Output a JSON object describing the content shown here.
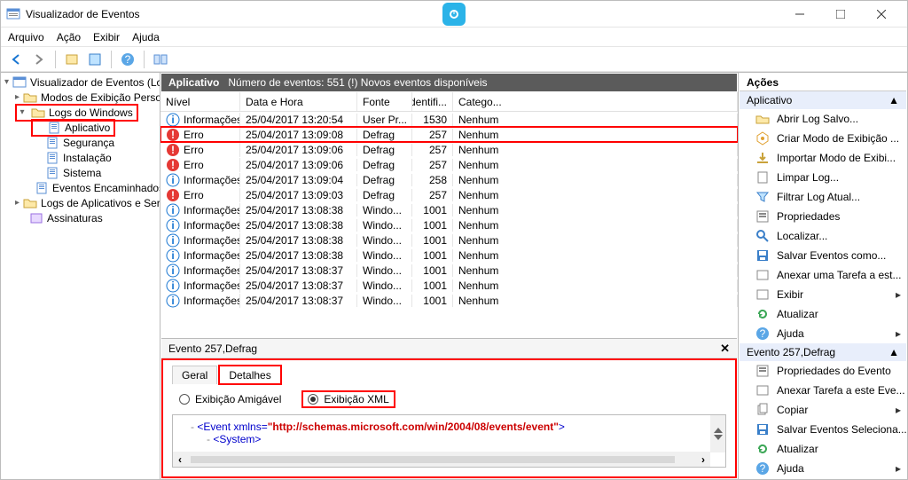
{
  "title": "Visualizador de Eventos",
  "menu": [
    "Arquivo",
    "Ação",
    "Exibir",
    "Ajuda"
  ],
  "tree": {
    "root": "Visualizador de Eventos (Local)",
    "items": [
      {
        "label": "Modos de Exibição Personali",
        "lvl": 1,
        "icon": "folder",
        "expander": "▸"
      },
      {
        "label": "Logs do Windows",
        "lvl": 1,
        "icon": "folder",
        "expander": "▾",
        "highlight": true
      },
      {
        "label": "Aplicativo",
        "lvl": 2,
        "icon": "log",
        "highlight": true
      },
      {
        "label": "Segurança",
        "lvl": 2,
        "icon": "log"
      },
      {
        "label": "Instalação",
        "lvl": 2,
        "icon": "log"
      },
      {
        "label": "Sistema",
        "lvl": 2,
        "icon": "log"
      },
      {
        "label": "Eventos Encaminhados",
        "lvl": 2,
        "icon": "log"
      },
      {
        "label": "Logs de Aplicativos e Serviço",
        "lvl": 1,
        "icon": "folder",
        "expander": "▸"
      },
      {
        "label": "Assinaturas",
        "lvl": 1,
        "icon": "subs"
      }
    ]
  },
  "center": {
    "header_title": "Aplicativo",
    "header_sub": "Número de eventos: 551 (!) Novos eventos disponíveis",
    "columns": {
      "level": "Nível",
      "date": "Data e Hora",
      "src": "Fonte",
      "id": "Identifi...",
      "cat": "Catego..."
    },
    "rows": [
      {
        "lvl": "info",
        "level": "Informações",
        "date": "25/04/2017 13:20:54",
        "src": "User Pr...",
        "id": "1530",
        "cat": "Nenhum"
      },
      {
        "lvl": "err",
        "level": "Erro",
        "date": "25/04/2017 13:09:08",
        "src": "Defrag",
        "id": "257",
        "cat": "Nenhum",
        "highlight": true
      },
      {
        "lvl": "err",
        "level": "Erro",
        "date": "25/04/2017 13:09:06",
        "src": "Defrag",
        "id": "257",
        "cat": "Nenhum"
      },
      {
        "lvl": "err",
        "level": "Erro",
        "date": "25/04/2017 13:09:06",
        "src": "Defrag",
        "id": "257",
        "cat": "Nenhum"
      },
      {
        "lvl": "info",
        "level": "Informações",
        "date": "25/04/2017 13:09:04",
        "src": "Defrag",
        "id": "258",
        "cat": "Nenhum"
      },
      {
        "lvl": "err",
        "level": "Erro",
        "date": "25/04/2017 13:09:03",
        "src": "Defrag",
        "id": "257",
        "cat": "Nenhum"
      },
      {
        "lvl": "info",
        "level": "Informações",
        "date": "25/04/2017 13:08:38",
        "src": "Windo...",
        "id": "1001",
        "cat": "Nenhum"
      },
      {
        "lvl": "info",
        "level": "Informações",
        "date": "25/04/2017 13:08:38",
        "src": "Windo...",
        "id": "1001",
        "cat": "Nenhum"
      },
      {
        "lvl": "info",
        "level": "Informações",
        "date": "25/04/2017 13:08:38",
        "src": "Windo...",
        "id": "1001",
        "cat": "Nenhum"
      },
      {
        "lvl": "info",
        "level": "Informações",
        "date": "25/04/2017 13:08:38",
        "src": "Windo...",
        "id": "1001",
        "cat": "Nenhum"
      },
      {
        "lvl": "info",
        "level": "Informações",
        "date": "25/04/2017 13:08:37",
        "src": "Windo...",
        "id": "1001",
        "cat": "Nenhum"
      },
      {
        "lvl": "info",
        "level": "Informações",
        "date": "25/04/2017 13:08:37",
        "src": "Windo...",
        "id": "1001",
        "cat": "Nenhum"
      },
      {
        "lvl": "info",
        "level": "Informações",
        "date": "25/04/2017 13:08:37",
        "src": "Windo...",
        "id": "1001",
        "cat": "Nenhum"
      }
    ]
  },
  "detail": {
    "title": "Evento 257,Defrag",
    "tabs": {
      "general": "Geral",
      "details": "Detalhes"
    },
    "radio": {
      "friendly": "Exibição Amigável",
      "xml": "Exibição XML"
    },
    "xml": {
      "event_open": "<Event xmlns=",
      "ns": "\"http://schemas.microsoft.com/win/2004/08/events/event\"",
      "event_close": ">",
      "system": "<System>"
    }
  },
  "actions": {
    "header": "Ações",
    "section1": "Aplicativo",
    "items1": [
      {
        "icon": "open",
        "label": "Abrir Log Salvo..."
      },
      {
        "icon": "view",
        "label": "Criar Modo de Exibição ..."
      },
      {
        "icon": "import",
        "label": "Importar Modo de Exibi..."
      },
      {
        "icon": "clear",
        "label": "Limpar Log..."
      },
      {
        "icon": "filter",
        "label": "Filtrar Log Atual..."
      },
      {
        "icon": "props",
        "label": "Propriedades"
      },
      {
        "icon": "find",
        "label": "Localizar..."
      },
      {
        "icon": "save",
        "label": "Salvar Eventos como..."
      },
      {
        "icon": "task",
        "label": "Anexar uma Tarefa a est..."
      },
      {
        "icon": "view2",
        "label": "Exibir",
        "sub": true
      },
      {
        "icon": "refresh",
        "label": "Atualizar"
      },
      {
        "icon": "help",
        "label": "Ajuda",
        "sub": true
      }
    ],
    "section2": "Evento 257,Defrag",
    "items2": [
      {
        "icon": "props",
        "label": "Propriedades do Evento"
      },
      {
        "icon": "task",
        "label": "Anexar Tarefa a este Eve..."
      },
      {
        "icon": "copy",
        "label": "Copiar",
        "sub": true
      },
      {
        "icon": "save",
        "label": "Salvar Eventos Seleciona..."
      },
      {
        "icon": "refresh",
        "label": "Atualizar"
      },
      {
        "icon": "help",
        "label": "Ajuda",
        "sub": true
      }
    ]
  }
}
